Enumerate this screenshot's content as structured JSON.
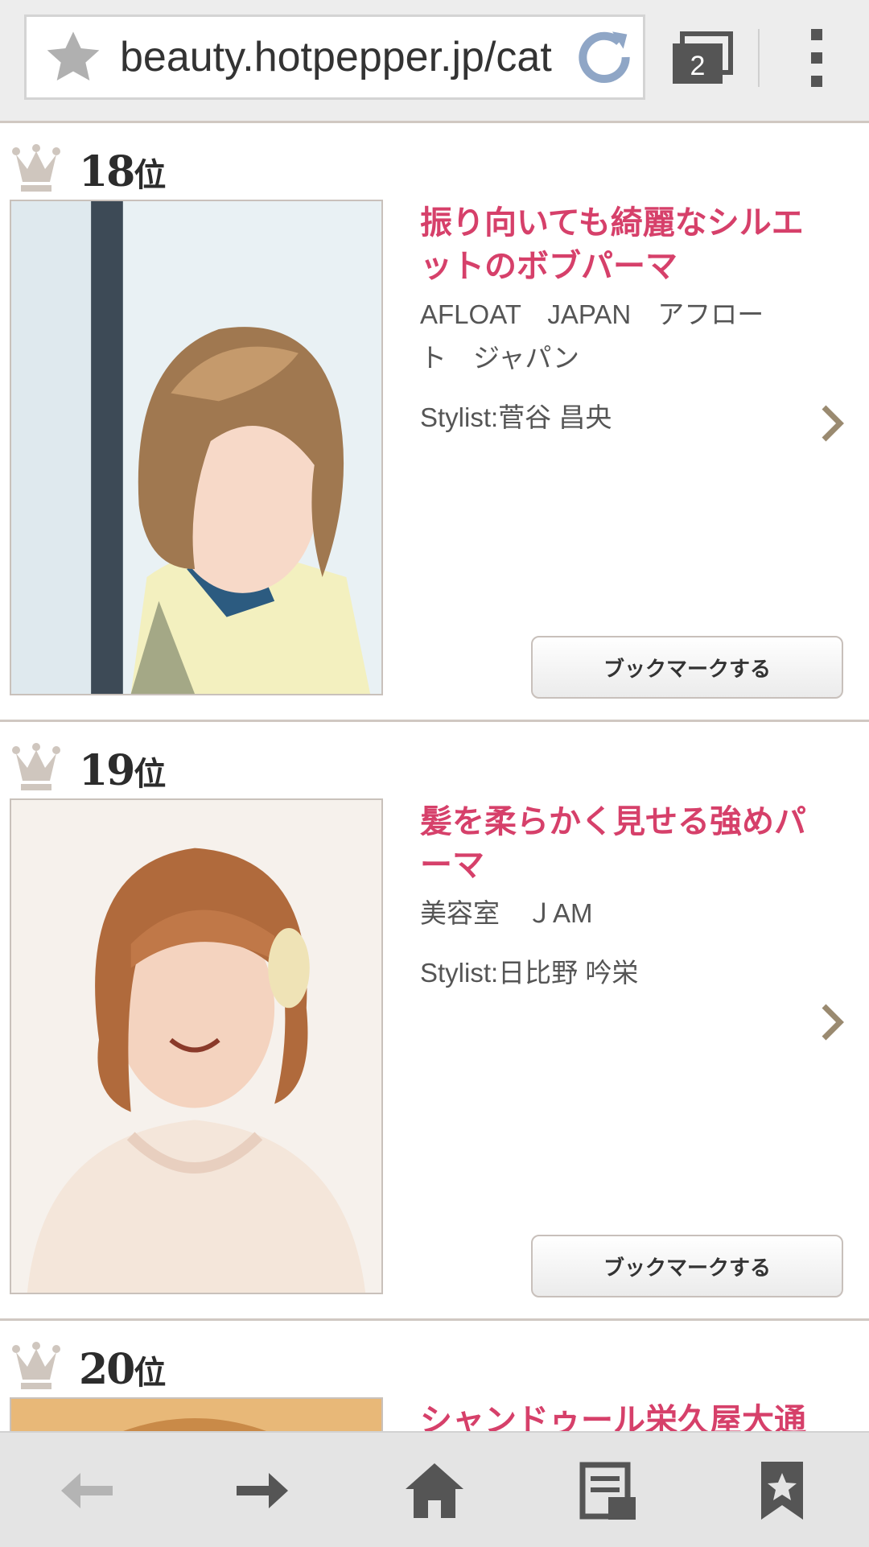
{
  "browser": {
    "url": "beauty.hotpepper.jp/cat",
    "tab_count": "2"
  },
  "ranking": [
    {
      "rank": "18",
      "unit": "位",
      "title_line1": "振り向いても綺麗なシルエ",
      "title_line2": "ットのボブパーマ",
      "salon_line1": "AFLOAT　JAPAN　アフロー",
      "salon_line2": "ト　ジャパン",
      "stylist": "Stylist:菅谷 昌央",
      "bookmark_label": "ブックマークする"
    },
    {
      "rank": "19",
      "unit": "位",
      "title_line1": "髪を柔らかく見せる強めパ",
      "title_line2": "ーマ",
      "salon_line1": "美容室　ＪAM",
      "stylist": "Stylist:日比野 吟栄",
      "bookmark_label": "ブックマークする"
    },
    {
      "rank": "20",
      "unit": "位",
      "title_line1": "シャンドゥール栄久屋大通"
    }
  ],
  "colors": {
    "title_pink": "#d6406a",
    "crown": "#cfc6be",
    "toolbar_icon": "#5a5a5a"
  },
  "icons": {
    "address_bar": [
      "star-icon",
      "reload-icon",
      "tabs-icon",
      "overflow-menu-icon"
    ],
    "toolbar": [
      "back-arrow-icon",
      "forward-arrow-icon",
      "home-icon",
      "reading-list-icon",
      "bookmarks-icon"
    ]
  }
}
